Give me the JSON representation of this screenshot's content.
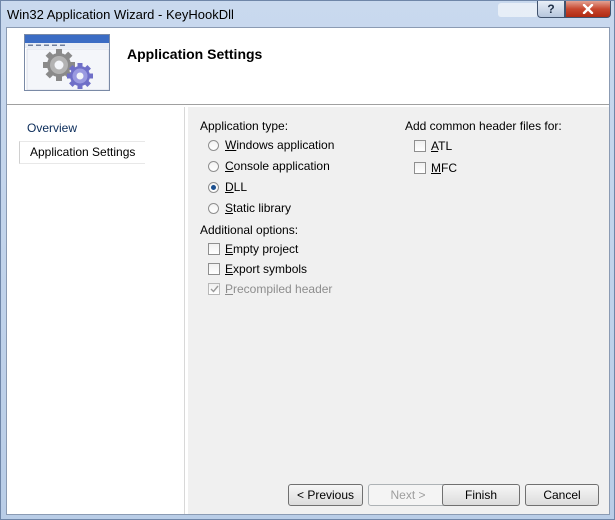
{
  "window": {
    "title": "Win32 Application Wizard - KeyHookDll"
  },
  "caption_buttons": {
    "help": "?"
  },
  "header": {
    "title": "Application Settings",
    "image_icon": "gears-icon"
  },
  "nav": {
    "items": [
      {
        "label": "Overview"
      },
      {
        "label": "Application Settings",
        "selected": true
      }
    ]
  },
  "app_type": {
    "label": "Application type:",
    "options": [
      {
        "first": "W",
        "rest": "indows application",
        "checked": false
      },
      {
        "first": "C",
        "rest": "onsole application",
        "checked": false
      },
      {
        "first": "D",
        "rest": "LL",
        "checked": true
      },
      {
        "first": "S",
        "rest": "tatic library",
        "checked": false
      }
    ]
  },
  "additional": {
    "label": "Additional options:",
    "options": [
      {
        "first": "E",
        "rest": "mpty project",
        "checked": false,
        "enabled": true
      },
      {
        "first": "E",
        "rest": "xport symbols",
        "checked": false,
        "enabled": true
      },
      {
        "first": "P",
        "rest": "recompiled header",
        "checked": true,
        "enabled": false
      }
    ]
  },
  "headers": {
    "label": "Add common header files for:",
    "options": [
      {
        "first": "A",
        "rest": "TL",
        "checked": false
      },
      {
        "first": "M",
        "rest": "FC",
        "checked": false
      }
    ]
  },
  "buttons": {
    "previous": "< Previous",
    "next": "Next >",
    "finish": "Finish",
    "cancel": "Cancel"
  }
}
